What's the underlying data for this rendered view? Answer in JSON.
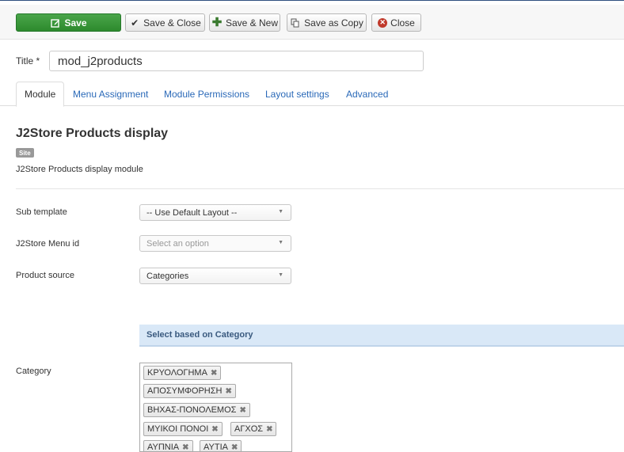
{
  "toolbar": {
    "save": "Save",
    "save_close": "Save & Close",
    "save_new": "Save & New",
    "save_copy": "Save as Copy",
    "close": "Close"
  },
  "title": {
    "label": "Title *",
    "value": "mod_j2products"
  },
  "tabs": [
    {
      "label": "Module",
      "active": true
    },
    {
      "label": "Menu Assignment",
      "active": false
    },
    {
      "label": "Module Permissions",
      "active": false
    },
    {
      "label": "Layout settings",
      "active": false
    },
    {
      "label": "Advanced",
      "active": false
    }
  ],
  "module": {
    "heading": "J2Store Products display",
    "badge": "Site",
    "description": "J2Store Products display module"
  },
  "fields": {
    "sub_template": {
      "label": "Sub template",
      "value": "-- Use Default Layout --"
    },
    "menu_id": {
      "label": "J2Store Menu id",
      "placeholder": "Select an option"
    },
    "product_source": {
      "label": "Product source",
      "value": "Categories"
    }
  },
  "category_section": {
    "heading": "Select based on Category",
    "label": "Category",
    "selected": [
      "ΚΡΥΟΛΟΓΗΜΑ",
      "ΑΠΟΣΥΜΦΟΡΗΣΗ",
      "ΒΗΧΑΣ-ΠΟΝΟΛΕΜΟΣ",
      "ΜΥΙΚΟΙ ΠΟΝΟΙ",
      "ΑΓΧΟΣ",
      "ΑΥΠΝΙΑ",
      "ΑΥΤΙΑ"
    ],
    "remove_glyph": "✖"
  },
  "colors": {
    "save_green": "#2d8a2d",
    "link_blue": "#2a69b8",
    "close_red": "#c0392b",
    "section_blue": "#d9e8f7"
  },
  "icons": {
    "save": "pencil-square-icon",
    "save_close": "checkmark-icon",
    "save_new": "plus-icon",
    "save_copy": "copy-icon",
    "close": "close-circle-icon",
    "select_caret": "chevron-down-icon"
  }
}
